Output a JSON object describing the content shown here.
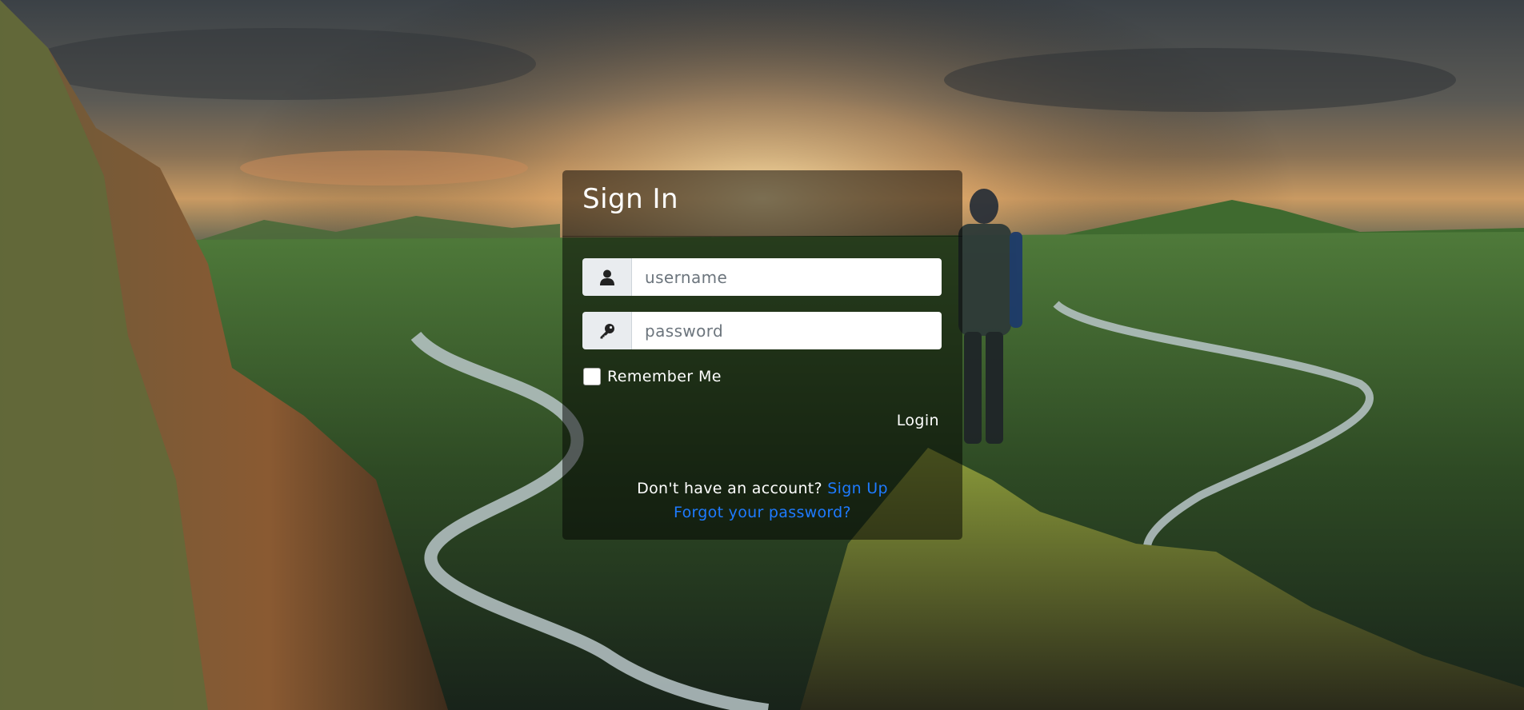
{
  "page": {
    "title": "Sign In"
  },
  "form": {
    "username_placeholder": "username",
    "password_placeholder": "password",
    "username_icon": "user-icon",
    "password_icon": "key-icon",
    "remember_label": "Remember Me",
    "remember_checked": false,
    "login_label": "Login"
  },
  "footer": {
    "question": "Don't have an account?",
    "signup_link": "Sign Up",
    "forgot_link": "Forgot your password?"
  },
  "colors": {
    "link": "#1e7bff",
    "card_bg": "rgba(0,0,0,0.50)",
    "text": "#ffffff"
  }
}
